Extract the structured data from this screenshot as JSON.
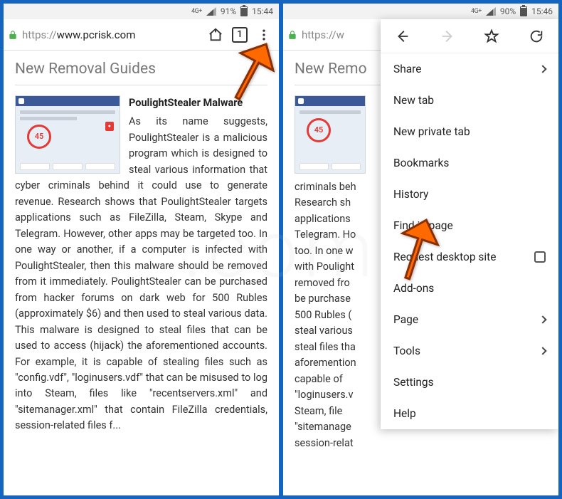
{
  "status": {
    "network": "4G+",
    "battery_left": "91%",
    "time_left": "15:44",
    "battery_right": "90%",
    "time_right": "15:46"
  },
  "browser": {
    "url_prefix": "https://",
    "url_host": "www.pcrisk.com",
    "url_truncated": "https://w",
    "tab_count": "1"
  },
  "page": {
    "section_title": "New Removal Guides",
    "section_title_truncated": "New Remo",
    "article_title": "PoulightStealer Malware",
    "thumb_score": "45",
    "article_body": "As its name suggests, PoulightStealer is a malicious program which is designed to steal various information that cyber criminals behind it could use to generate revenue. Research shows that PoulightStealer targets applications such as FileZilla, Steam, Skype and Telegram. However, other apps may be targeted too. In one way or another, if a computer is infected with PoulightStealer, then this malware should be removed from it immediately. PoulightStealer can be purchased from hacker forums on dark web for 500 Rubles (approximately $6) and then used to steal various data. This malware is designed to steal files that can be used to access (hijack) the aforementioned accounts. For example, it is capable of stealing files such as \"config.vdf\", \"loginusers.vdf\" that can be misused to log into Steam, files like \"recentservers.xml\" and \"sitemanager.xml\" that contain FileZilla credentials, session-related files f...",
    "article_body_truncated": "criminals behind it could use to generate revenue. Research shows that PoulightStealer targets applications such as FileZilla, Steam, Skype and Telegram. However, other apps may be targeted too. In one way or another, if a computer is infected with PoulightStealer, then this malware should be removed from it immediately. PoulightStealer can be purchased from hacker forums on dark web for 500 Rubles (approximately $6) and then used to steal various data. This malware is designed to steal files that can be used to access (hijack) the aforementioned accounts. For example, it is capable of stealing files such as \"config.vdf\", \"loginusers.vdf\" that can be misused to log into Steam, files like \"recentservers.xml\" and \"sitemanager.xml\" that contain FileZilla credentials, session-related files f..."
  },
  "menu": {
    "items": {
      "share": "Share",
      "new_tab": "New tab",
      "new_private": "New private tab",
      "bookmarks": "Bookmarks",
      "history": "History",
      "find": "Find in page",
      "desktop": "Request desktop site",
      "addons": "Add-ons",
      "page": "Page",
      "tools": "Tools",
      "settings": "Settings",
      "help": "Help"
    }
  },
  "watermark": ".com"
}
